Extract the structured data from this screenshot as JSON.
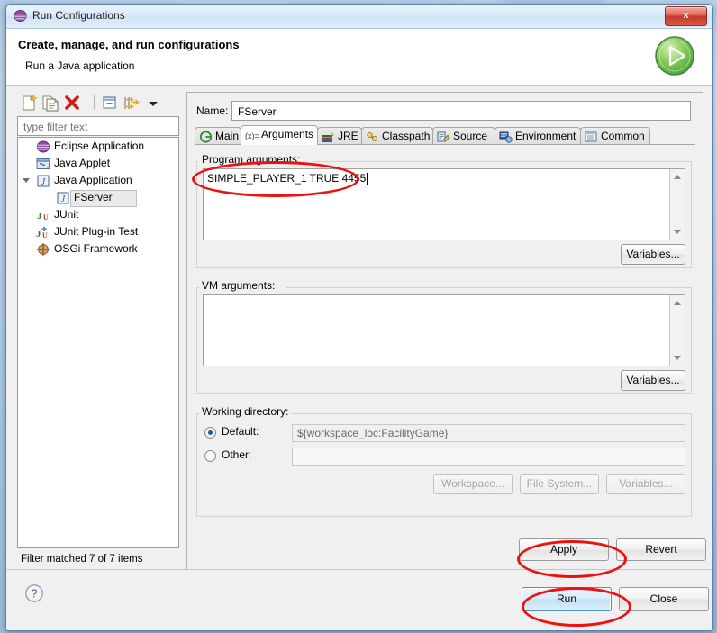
{
  "window": {
    "title": "Run Configurations",
    "close_label": "x",
    "icon": "eclipse-sphere-icon"
  },
  "header": {
    "title": "Create, manage, and run configurations",
    "subtitle": "Run a Java application",
    "run_icon": "green-play-icon"
  },
  "toolbar": {
    "buttons": [
      {
        "name": "new-launch-configuration",
        "icon": "new-document-icon"
      },
      {
        "name": "duplicate-launch-configuration",
        "icon": "copy-document-icon"
      },
      {
        "name": "delete-launch-configuration",
        "icon": "red-x-icon"
      },
      {
        "name": "collapse-all",
        "icon": "collapse-all-icon"
      },
      {
        "name": "filter-launch-configurations",
        "icon": "filter-arrow-icon"
      },
      {
        "name": "view-menu",
        "icon": "chevron-down-icon"
      }
    ]
  },
  "filter": {
    "placeholder": "type filter text",
    "value": "",
    "status": "Filter matched 7 of 7 items"
  },
  "tree": {
    "items": [
      {
        "label": "Eclipse Application",
        "icon": "eclipse-sphere-icon",
        "depth": 1,
        "twisty": "none",
        "selected": false
      },
      {
        "label": "Java Applet",
        "icon": "java-applet-icon",
        "depth": 1,
        "twisty": "none",
        "selected": false
      },
      {
        "label": "Java Application",
        "icon": "java-application-icon",
        "depth": 1,
        "twisty": "open",
        "selected": false
      },
      {
        "label": "FServer",
        "icon": "java-application-icon",
        "depth": 2,
        "twisty": "none",
        "selected": true
      },
      {
        "label": "JUnit",
        "icon": "junit-icon",
        "depth": 1,
        "twisty": "none",
        "selected": false
      },
      {
        "label": "JUnit Plug-in Test",
        "icon": "junit-plugin-icon",
        "depth": 1,
        "twisty": "none",
        "selected": false
      },
      {
        "label": "OSGi Framework",
        "icon": "osgi-icon",
        "depth": 1,
        "twisty": "none",
        "selected": false
      }
    ]
  },
  "config": {
    "name_label": "Name:",
    "name_value": "FServer"
  },
  "tabs": [
    {
      "label": "Main",
      "icon": "main-tab-icon",
      "selected": false
    },
    {
      "label": "Arguments",
      "icon": "arguments-tab-icon",
      "selected": true
    },
    {
      "label": "JRE",
      "icon": "jre-tab-icon",
      "selected": false
    },
    {
      "label": "Classpath",
      "icon": "classpath-tab-icon",
      "selected": false
    },
    {
      "label": "Source",
      "icon": "source-tab-icon",
      "selected": false
    },
    {
      "label": "Environment",
      "icon": "environment-tab-icon",
      "selected": false
    },
    {
      "label": "Common",
      "icon": "common-tab-icon",
      "selected": false
    }
  ],
  "program_arguments": {
    "caption": "Program arguments:",
    "value": "SIMPLE_PLAYER_1 TRUE 4455",
    "variables_label": "Variables..."
  },
  "vm_arguments": {
    "caption": "VM arguments:",
    "value": "",
    "variables_label": "Variables..."
  },
  "working_directory": {
    "caption": "Working directory:",
    "default_label": "Default:",
    "default_value": "${workspace_loc:FacilityGame}",
    "default_selected": true,
    "other_label": "Other:",
    "other_value": "",
    "other_selected": false,
    "workspace_label": "Workspace...",
    "filesystem_label": "File System...",
    "variables_label": "Variables..."
  },
  "actions": {
    "apply_label": "Apply",
    "revert_label": "Revert",
    "run_label": "Run",
    "close_label": "Close",
    "help_icon": "help-question-icon"
  },
  "colors": {
    "annotation": "#ee1111",
    "default_button_border": "#4a90c4",
    "title_bar_close": "#c23a2c"
  }
}
